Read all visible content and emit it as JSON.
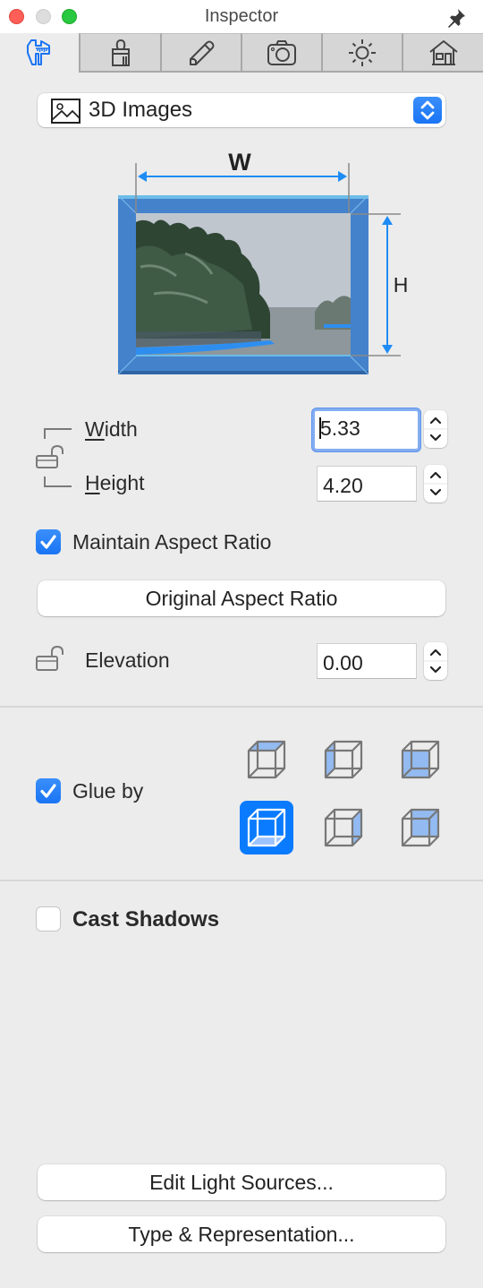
{
  "window": {
    "title": "Inspector",
    "pin_icon": "pin-icon"
  },
  "tabs": [
    {
      "name": "dimensions",
      "icon": "caliper-icon",
      "active": true
    },
    {
      "name": "material",
      "icon": "brush-icon",
      "active": false
    },
    {
      "name": "edit",
      "icon": "pencil-icon",
      "active": false
    },
    {
      "name": "camera",
      "icon": "camera-icon",
      "active": false
    },
    {
      "name": "lighting",
      "icon": "sun-icon",
      "active": false
    },
    {
      "name": "building",
      "icon": "house-icon",
      "active": false
    }
  ],
  "object_type": {
    "selected": "3D Images",
    "icon": "image-icon"
  },
  "diagram": {
    "width_label": "W",
    "height_label": "H"
  },
  "dimensions": {
    "width_label": "Width",
    "width_mnemonic": "W",
    "width_rest": "idth",
    "width_value": "5.33",
    "height_label": "Height",
    "height_mnemonic": "H",
    "height_rest": "eight",
    "height_value": "4.20",
    "proportions_locked": false
  },
  "maintain_aspect_ratio": {
    "label": "Maintain Aspect Ratio",
    "checked": true
  },
  "original_aspect_ratio_button": "Original Aspect Ratio",
  "elevation": {
    "label": "Elevation",
    "value": "0.00",
    "locked": false
  },
  "glue_by": {
    "label": "Glue by",
    "checked": true,
    "options": [
      {
        "face": "top",
        "selected": false
      },
      {
        "face": "left",
        "selected": false
      },
      {
        "face": "front",
        "selected": false
      },
      {
        "face": "bottom",
        "selected": true
      },
      {
        "face": "right",
        "selected": false
      },
      {
        "face": "back",
        "selected": false
      }
    ]
  },
  "cast_shadows": {
    "label": "Cast Shadows",
    "checked": false
  },
  "buttons": {
    "edit_light_sources": "Edit Light Sources...",
    "type_representation": "Type & Representation..."
  },
  "colors": {
    "accent": "#1a74f4",
    "frame_blue": "#4482cc",
    "dimension_blue": "#1e8cf5"
  }
}
